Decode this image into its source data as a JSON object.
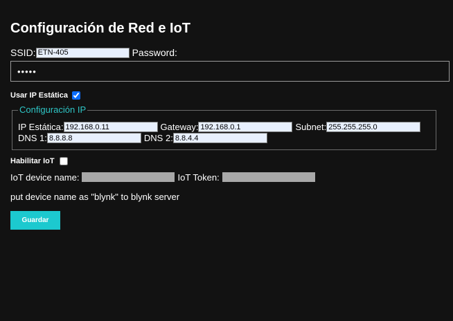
{
  "page": {
    "title": "Configuración de Red e IoT"
  },
  "wifi": {
    "ssid_label": "SSID:",
    "ssid_value": "ETN-405",
    "password_label": "Password:",
    "password_value": "12345"
  },
  "static_ip": {
    "label": "Usar IP Estática",
    "checked": true
  },
  "ip_config": {
    "legend": "Configuración IP",
    "ip_label": "IP Estática:",
    "ip_value": "192.168.0.11",
    "gateway_label": "Gateway:",
    "gateway_value": "192.168.0.1",
    "subnet_label": "Subnet:",
    "subnet_value": "255.255.255.0",
    "dns1_label": "DNS 1:",
    "dns1_value": "8.8.8.8",
    "dns2_label": "DNS 2:",
    "dns2_value": "8.8.4.4"
  },
  "iot": {
    "enable_label": "Habilitar IoT",
    "enabled": false,
    "device_name_label": "IoT device name:",
    "token_label": "IoT Token:",
    "note": "put device name as \"blynk\" to blynk server"
  },
  "actions": {
    "save_label": "Guardar"
  },
  "colors": {
    "background": "#121212",
    "accent": "#1cc9cf",
    "legend": "#2ec6c6",
    "input_fill": "#e8f0fe",
    "disabled_input": "#a8a8a8"
  }
}
